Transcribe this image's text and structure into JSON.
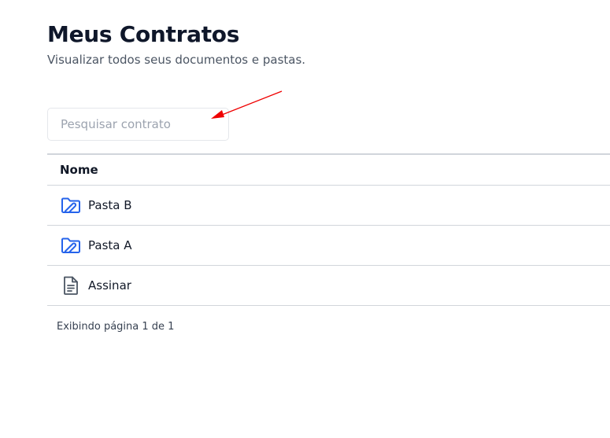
{
  "page": {
    "title": "Meus Contratos",
    "subtitle": "Visualizar todos seus documentos e pastas."
  },
  "search": {
    "placeholder": "Pesquisar contrato",
    "value": ""
  },
  "table": {
    "columns": [
      "Nome"
    ],
    "rows": [
      {
        "name": "Pasta B",
        "icon": "folder-icon"
      },
      {
        "name": "Pasta A",
        "icon": "folder-icon"
      },
      {
        "name": "Assinar",
        "icon": "document-icon"
      }
    ]
  },
  "pagination": {
    "text": "Exibindo página 1 de 1"
  },
  "colors": {
    "folder_icon": "#2563eb",
    "document_icon": "#4b5563",
    "annotation_arrow": "#ef0000"
  }
}
